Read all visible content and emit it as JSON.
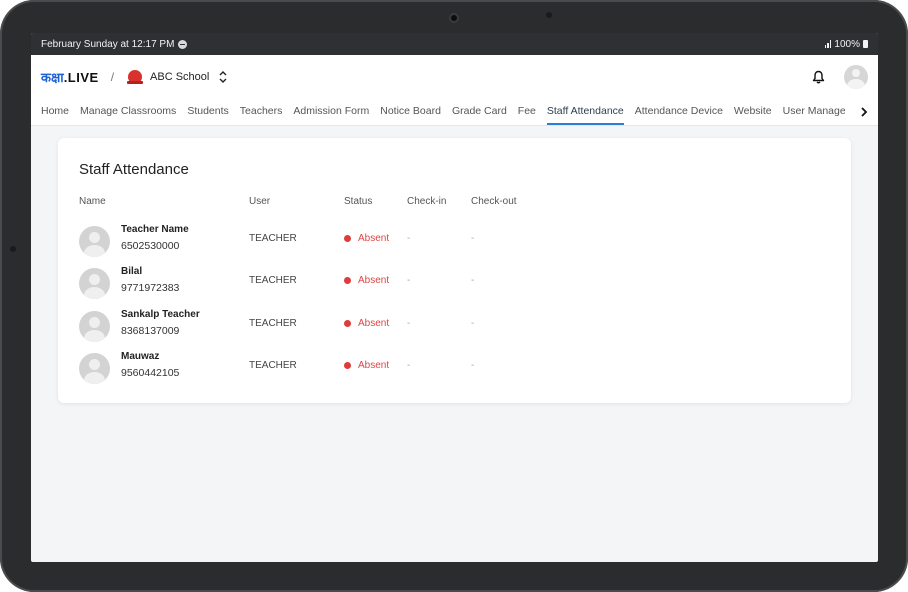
{
  "status_bar": {
    "datetime": "February Sunday at 12:17 PM",
    "battery": "100%"
  },
  "app": {
    "logo_hindi": "कक्षा",
    "logo_live": ".LIVE",
    "separator": "/",
    "school_name": "ABC School"
  },
  "tabs": [
    {
      "label": "Home"
    },
    {
      "label": "Manage Classrooms"
    },
    {
      "label": "Students"
    },
    {
      "label": "Teachers"
    },
    {
      "label": "Admission Form"
    },
    {
      "label": "Notice Board"
    },
    {
      "label": "Grade Card"
    },
    {
      "label": "Fee"
    },
    {
      "label": "Staff Attendance",
      "active": true
    },
    {
      "label": "Attendance Device"
    },
    {
      "label": "Website"
    },
    {
      "label": "User Manage"
    }
  ],
  "card": {
    "title": "Staff Attendance",
    "columns": {
      "name": "Name",
      "user": "User",
      "status": "Status",
      "checkin": "Check-in",
      "checkout": "Check-out"
    },
    "rows": [
      {
        "name": "Teacher Name",
        "phone": "6502530000",
        "user": "TEACHER",
        "status": "Absent",
        "checkin": "-",
        "checkout": "-"
      },
      {
        "name": "Bilal",
        "phone": "9771972383",
        "user": "TEACHER",
        "status": "Absent",
        "checkin": "-",
        "checkout": "-"
      },
      {
        "name": "Sankalp Teacher",
        "phone": "8368137009",
        "user": "TEACHER",
        "status": "Absent",
        "checkin": "-",
        "checkout": "-"
      },
      {
        "name": "Mauwaz",
        "phone": "9560442105",
        "user": "TEACHER",
        "status": "Absent",
        "checkin": "-",
        "checkout": "-"
      }
    ]
  },
  "colors": {
    "accent": "#2b7fd6",
    "logo_blue": "#1e63d6",
    "absent_red": "#e04545"
  }
}
